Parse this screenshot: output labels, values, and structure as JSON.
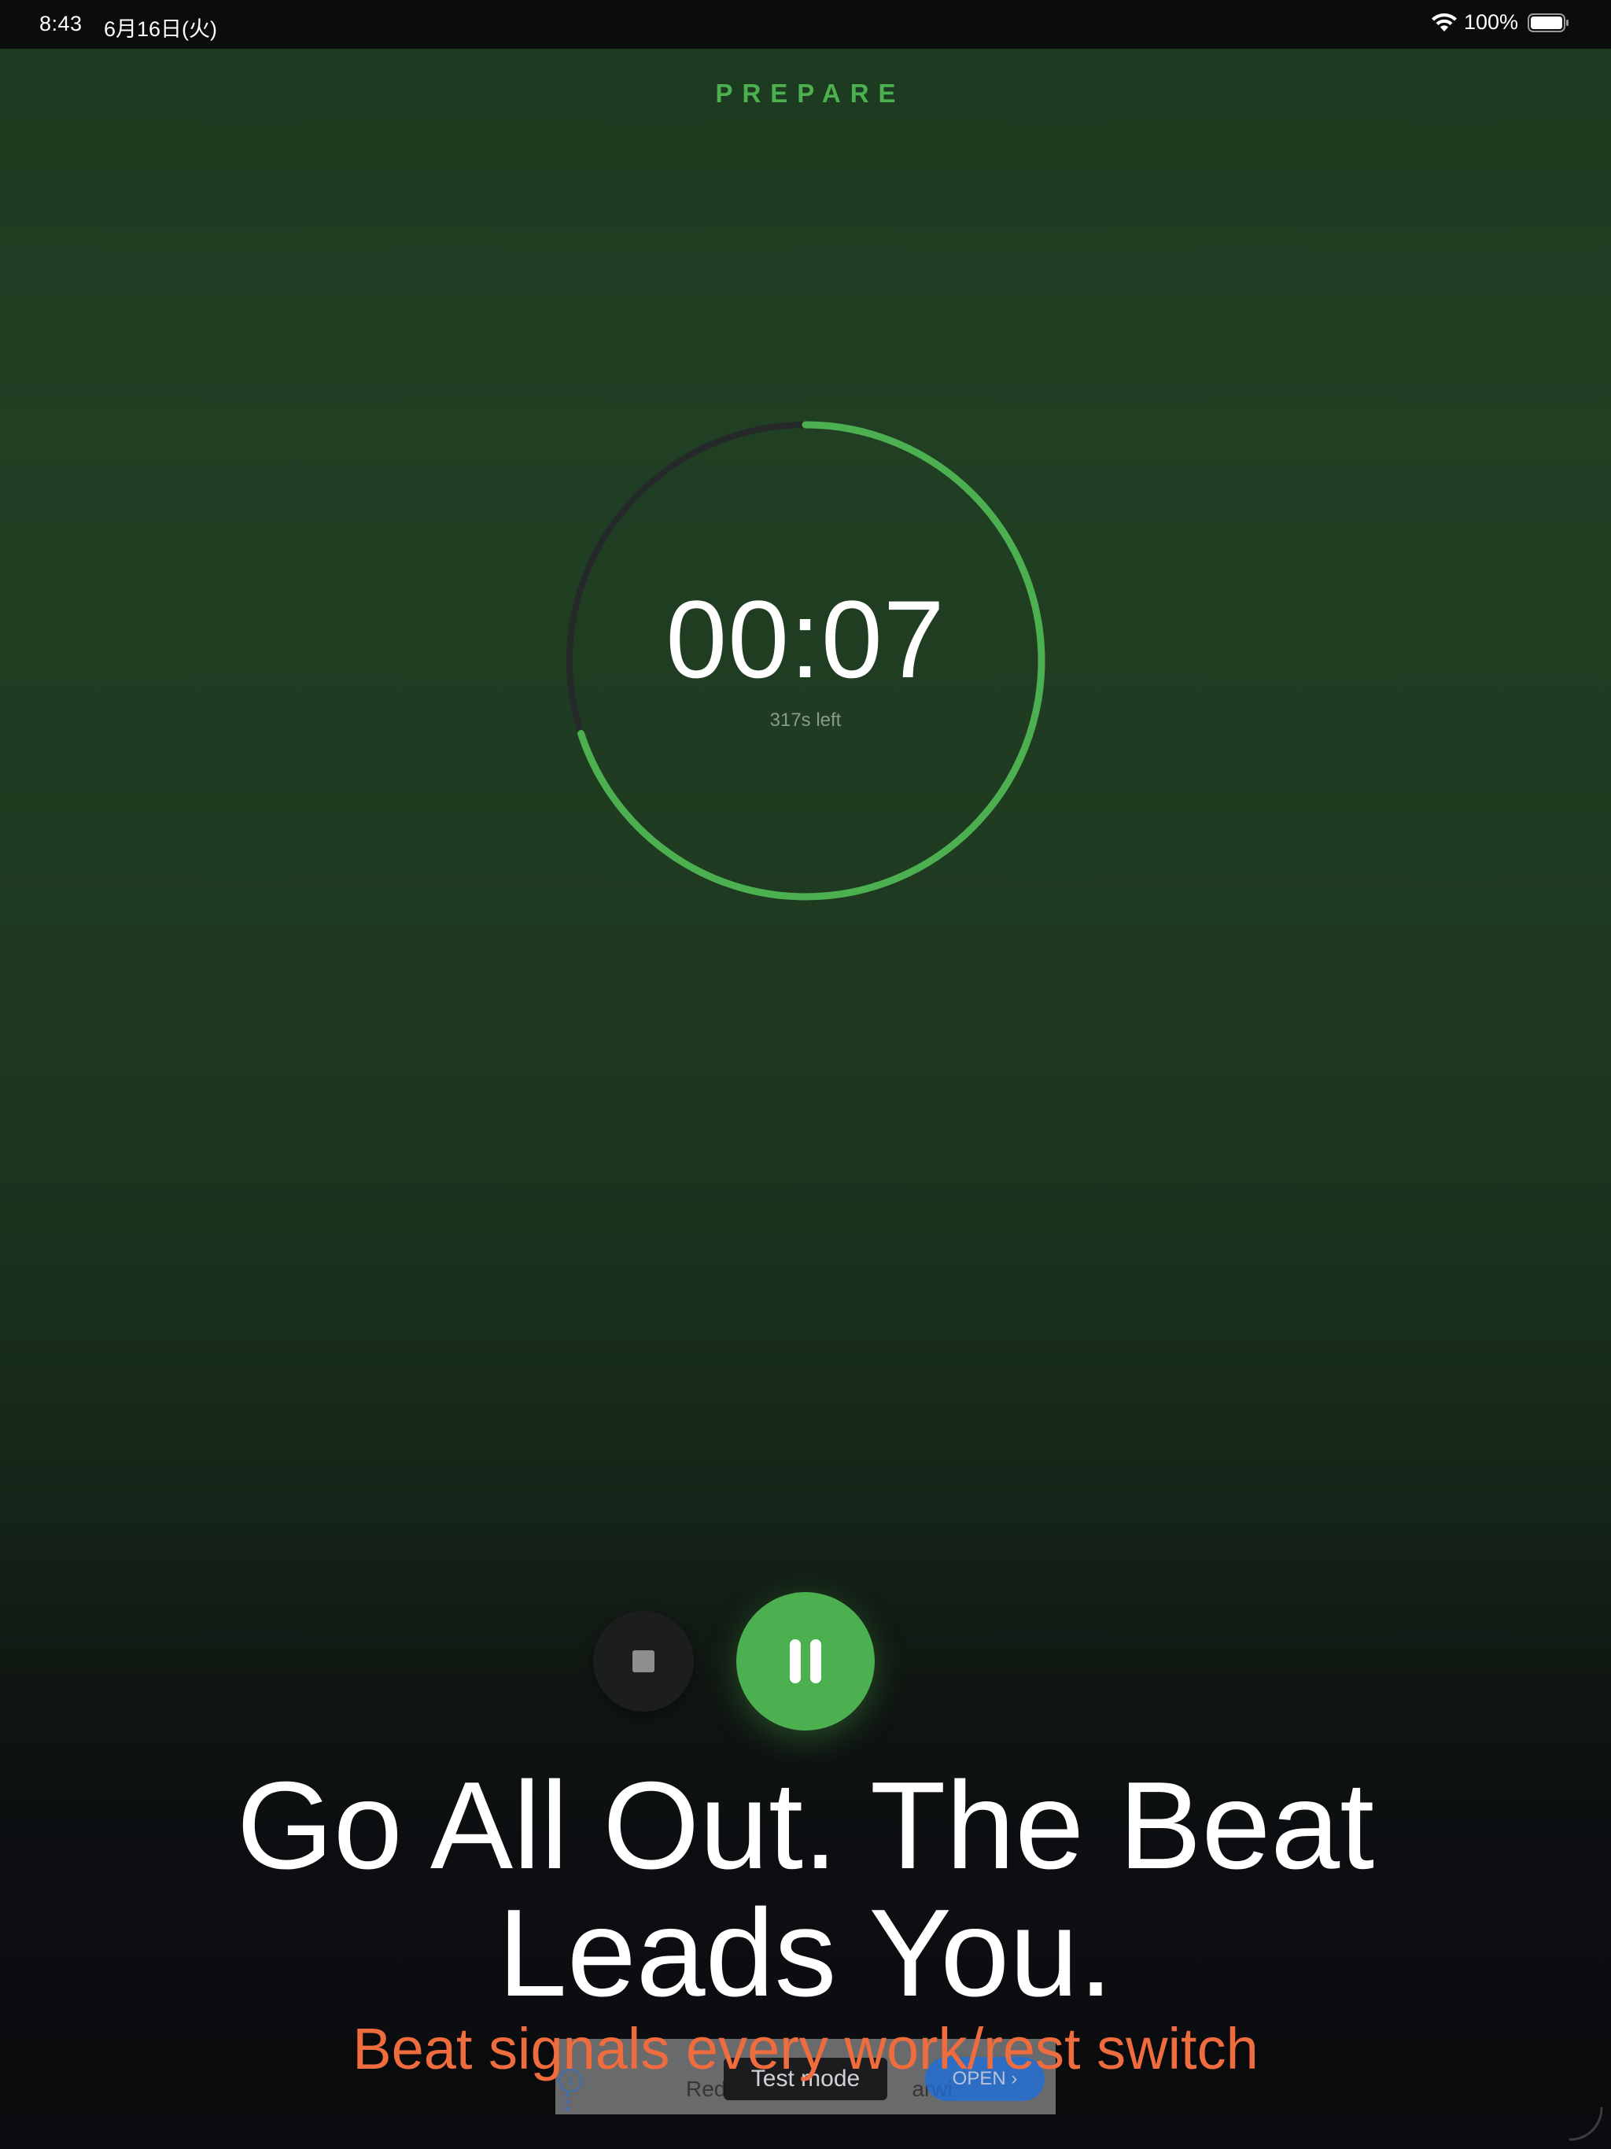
{
  "status_bar": {
    "time": "8:43",
    "date": "6月16日(火)",
    "battery_percent": "100%",
    "wifi_icon": "wifi-icon",
    "battery_icon": "battery-full-icon"
  },
  "phase": {
    "label": "PREPARE",
    "color": "#4caf50"
  },
  "timer": {
    "display": "00:07",
    "remaining_text": "317s left",
    "progress_fraction": 0.7,
    "ring_color": "#4caf50",
    "track_color": "#26292a"
  },
  "controls": {
    "stop_icon": "stop-icon",
    "pause_icon": "pause-icon",
    "pause_color": "#4caf50"
  },
  "headline": {
    "text": "Go All Out. The Beat Leads You.",
    "subtext": "Beat signals every work/rest switch",
    "subtext_color": "#ef6c3e"
  },
  "ad": {
    "headline_partial": "Red",
    "headline_partial2": "arwi",
    "test_mode_label": "Test mode",
    "open_label": "OPEN ›",
    "info_icon": "info-icon",
    "menu_icon": "more-vertical-icon"
  }
}
